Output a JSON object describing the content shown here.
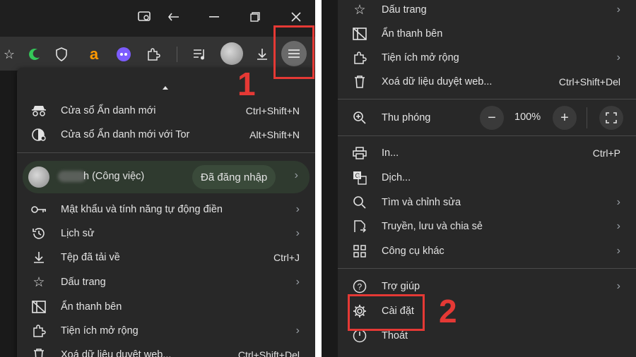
{
  "left": {
    "profile_name": "h (Công việc)",
    "signed_in": "Đã đăng nhập",
    "menu_items": [
      {
        "label": "Cửa sổ Ẩn danh mới",
        "shortcut": "Ctrl+Shift+N",
        "icon": "incognito-icon"
      },
      {
        "label": "Cửa sổ Ẩn danh mới với Tor",
        "shortcut": "Alt+Shift+N",
        "icon": "tor-icon"
      },
      {
        "label": "Mật khẩu và tính năng tự động điền",
        "arrow": "›",
        "icon": "key-icon"
      },
      {
        "label": "Lịch sử",
        "arrow": "›",
        "icon": "history-icon"
      },
      {
        "label": "Tệp đã tải về",
        "shortcut": "Ctrl+J",
        "icon": "download-icon"
      },
      {
        "label": "Dấu trang",
        "arrow": "›",
        "icon": "star-icon"
      },
      {
        "label": "Ẩn thanh bên",
        "icon": "sidebar-icon"
      },
      {
        "label": "Tiện ích mở rộng",
        "arrow": "›",
        "icon": "extension-icon"
      },
      {
        "label": "Xoá dữ liệu duyệt web...",
        "shortcut": "Ctrl+Shift+Del",
        "icon": "trash-icon"
      }
    ],
    "step_number": "1"
  },
  "right": {
    "menu_items": [
      {
        "label": "Dấu trang",
        "arrow": "›",
        "icon": "star-icon"
      },
      {
        "label": "Ẩn thanh bên",
        "icon": "sidebar-icon"
      },
      {
        "label": "Tiện ích mở rộng",
        "arrow": "›",
        "icon": "extension-icon"
      },
      {
        "label": "Xoá dữ liệu duyệt web...",
        "shortcut": "Ctrl+Shift+Del",
        "icon": "trash-icon"
      }
    ],
    "zoom_label": "Thu phóng",
    "zoom_value": "100%",
    "zoom_minus": "−",
    "zoom_plus": "+",
    "menu_items_2": [
      {
        "label": "In...",
        "shortcut": "Ctrl+P",
        "icon": "printer-icon"
      },
      {
        "label": "Dịch...",
        "icon": "translate-icon"
      },
      {
        "label": "Tìm và chỉnh sửa",
        "arrow": "›",
        "icon": "search-icon"
      },
      {
        "label": "Truyền, lưu và chia sẻ",
        "arrow": "›",
        "icon": "cast-icon"
      },
      {
        "label": "Công cụ khác",
        "arrow": "›",
        "icon": "tools-icon"
      }
    ],
    "menu_items_3": [
      {
        "label": "Trợ giúp",
        "arrow": "›",
        "icon": "help-icon"
      },
      {
        "label": "Cài đặt",
        "icon": "gear-icon"
      },
      {
        "label": "Thoát",
        "icon": "power-icon"
      }
    ],
    "step_number": "2"
  },
  "colors": {
    "highlight": "#e53935",
    "menu_bg": "#282828"
  }
}
